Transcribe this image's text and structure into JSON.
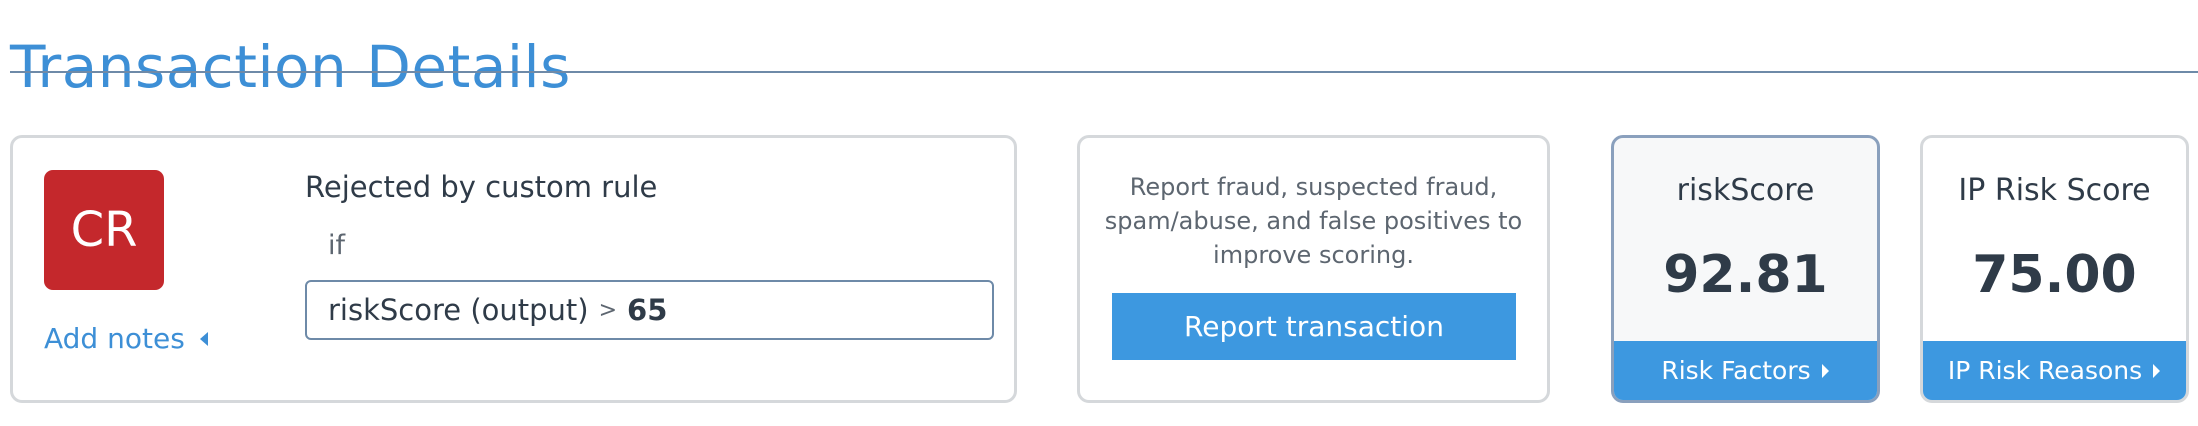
{
  "page": {
    "title": "Transaction Details"
  },
  "rule_card": {
    "badge": "CR",
    "heading": "Rejected by custom rule",
    "if_label": "if",
    "condition_field": "riskScore (output)",
    "condition_operator": ">",
    "condition_value": "65",
    "add_notes_label": "Add notes"
  },
  "report_card": {
    "description": "Report fraud, suspected fraud, spam/abuse, and false positives to improve scoring.",
    "button_label": "Report transaction"
  },
  "risk_score_card": {
    "label": "riskScore",
    "value": "92.81",
    "footer_label": "Risk Factors"
  },
  "ip_risk_card": {
    "label": "IP Risk Score",
    "value": "75.00",
    "footer_label": "IP Risk Reasons"
  },
  "colors": {
    "accent": "#3d8fd6",
    "button": "#3d98e0",
    "badge": "#c4282c",
    "text": "#2f3b48"
  }
}
